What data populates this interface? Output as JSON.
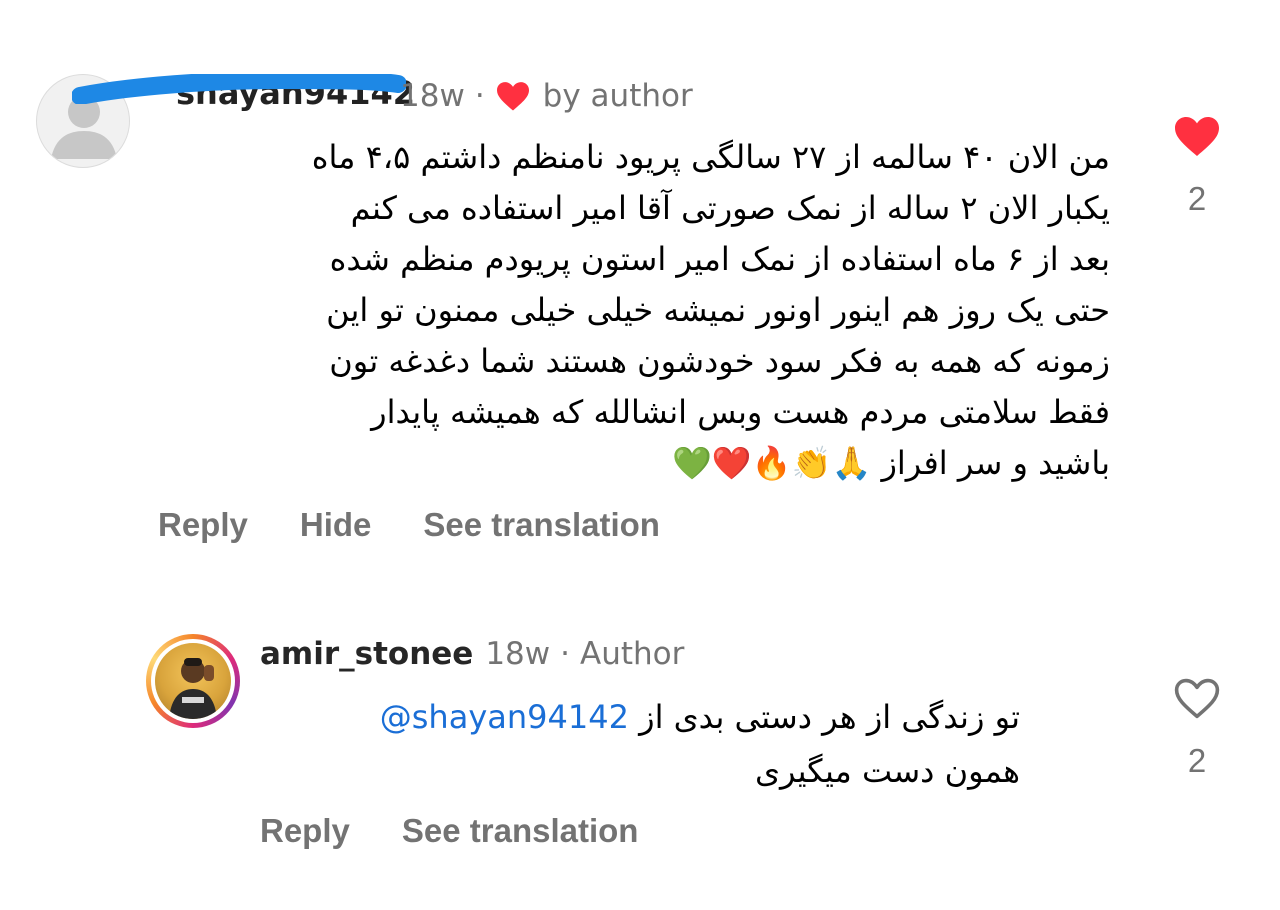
{
  "comment": {
    "username": "shayan94142",
    "time": "18w",
    "separator": "·",
    "liked_by_author": "by author",
    "lines": [
      "من الان ۴۰ سالمه از ۲۷ سالگی پریود نامنظم داشتم ۴،۵ ماه",
      "یکبار الان ۲ ساله از نمک صورتی آقا امیر استفاده می کنم",
      "بعد از ۶ ماه استفاده از نمک امیر استون پریودم منظم شده",
      "حتی یک روز هم اینور اونور نمیشه خیلی خیلی ممنون تو این",
      "زمونه که همه به فکر سود خودشون هستند شما دغدغه تون",
      "فقط سلامتی مردم هست وبس انشالله که همیشه پایدار",
      "باشید و سر افراز 🙏👏🔥❤️💚"
    ],
    "actions": {
      "reply": "Reply",
      "hide": "Hide",
      "translate": "See translation"
    },
    "like_count": "2",
    "liked": true
  },
  "reply": {
    "username": "amir_stonee",
    "time": "18w",
    "separator": "·",
    "badge": "Author",
    "mention": "@shayan94142",
    "line1_text": "تو زندگی از هر دستی بدی از",
    "line2": "همون دست میگیری",
    "actions": {
      "reply": "Reply",
      "translate": "See translation"
    },
    "like_count": "2",
    "liked": false
  },
  "colors": {
    "heart_red": "#ff3040",
    "meta_gray": "#737373",
    "mention_blue": "#1a6ed6",
    "redaction_blue": "#1e88e5"
  }
}
